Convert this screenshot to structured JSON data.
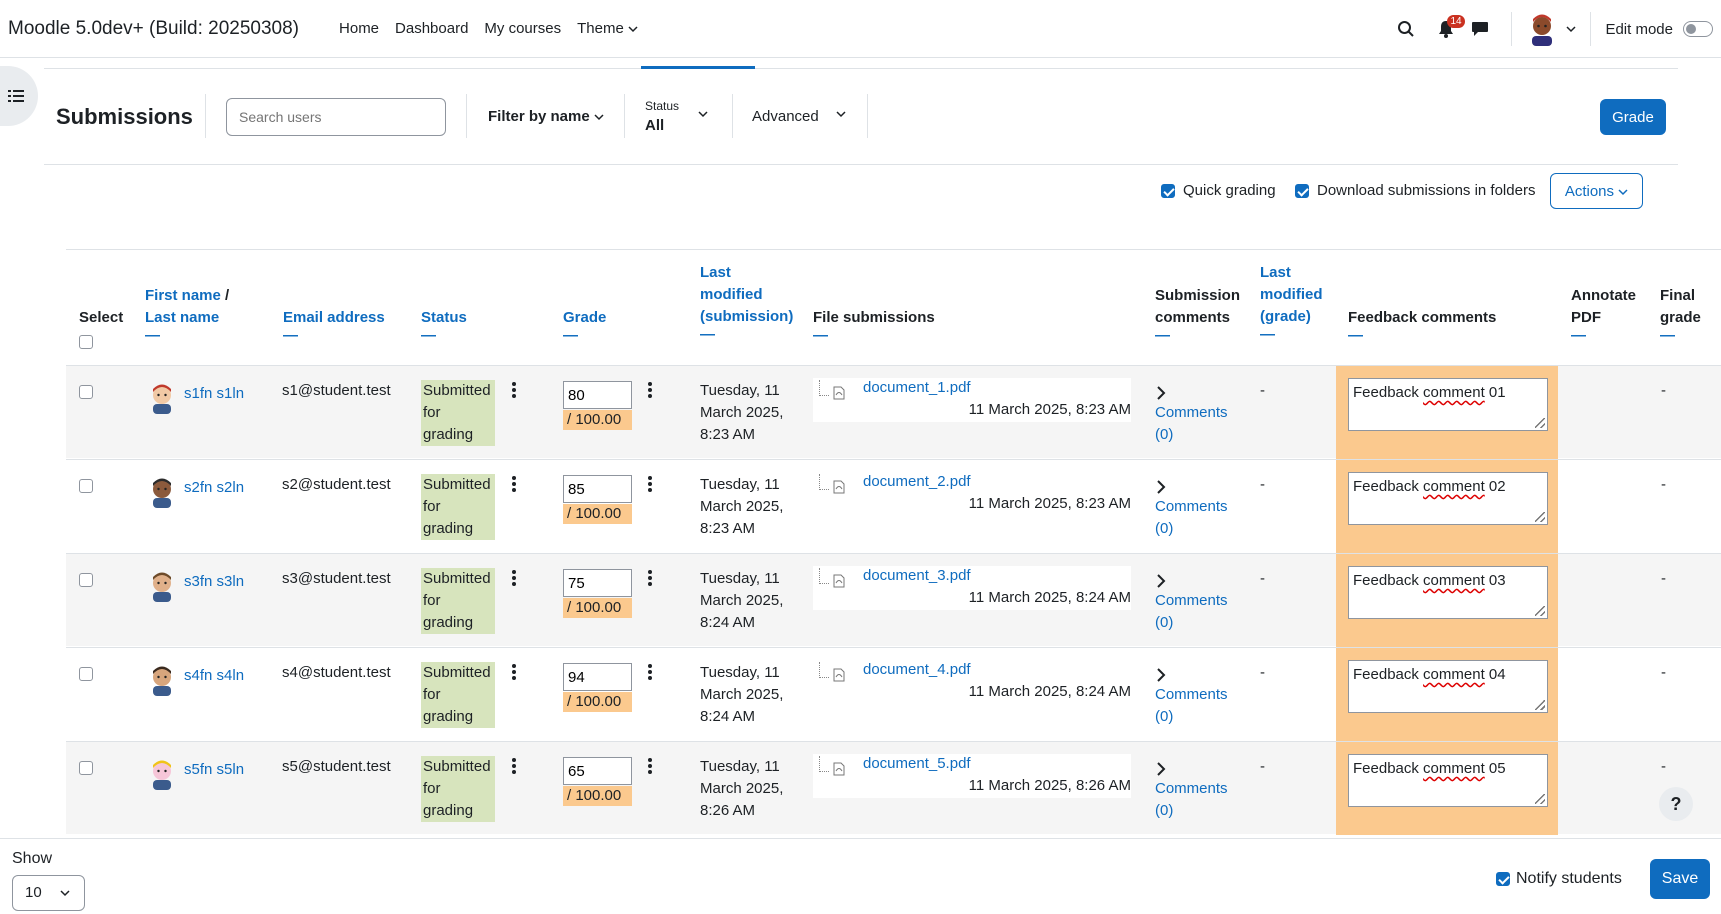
{
  "navbar": {
    "brand": "Moodle 5.0dev+ (Build: 20250308)",
    "links": [
      "Home",
      "Dashboard",
      "My courses",
      "Theme"
    ],
    "notification_count": "14",
    "edit_mode_label": "Edit mode"
  },
  "toolbar": {
    "title": "Submissions",
    "search_placeholder": "Search users",
    "filter_by_name": "Filter by name",
    "status_label": "Status",
    "status_value": "All",
    "advanced": "Advanced",
    "grade_button": "Grade",
    "quick_grading": "Quick grading",
    "download_folders": "Download submissions in folders",
    "actions": "Actions"
  },
  "table": {
    "headers": {
      "select": "Select",
      "first_name": "First name",
      "name_sep": "/",
      "last_name": "Last name",
      "email": "Email address",
      "status": "Status",
      "grade": "Grade",
      "last_modified_sub_1": "Last",
      "last_modified_sub_2": "modified",
      "last_modified_sub_3": "(submission)",
      "file_submissions": "File submissions",
      "submission_comments_1": "Submission",
      "submission_comments_2": "comments",
      "last_modified_grade_1": "Last",
      "last_modified_grade_2": "modified",
      "last_modified_grade_3": "(grade)",
      "feedback_comments": "Feedback comments",
      "annotate_pdf_1": "Annotate",
      "annotate_pdf_2": "PDF",
      "final_grade_1": "Final",
      "final_grade_2": "grade",
      "sort_dash": "—"
    },
    "rows": [
      {
        "name": "s1fn s1ln",
        "email": "s1@student.test",
        "status_1": "Submitted",
        "status_2": "for",
        "status_3": "grading",
        "grade": "80",
        "grade_max": "/ 100.00",
        "modified_1": "Tuesday, 11",
        "modified_2": "March 2025,",
        "modified_3": "8:23 AM",
        "file": "document_1.pdf",
        "file_date": "11 March 2025, 8:23 AM",
        "comments_1": "Comments",
        "comments_2": "(0)",
        "last_graded": "-",
        "feedback_word_1": "Feedback",
        "feedback_word_2": "comment",
        "feedback_word_3": "01",
        "final": "-"
      },
      {
        "name": "s2fn s2ln",
        "email": "s2@student.test",
        "status_1": "Submitted",
        "status_2": "for",
        "status_3": "grading",
        "grade": "85",
        "grade_max": "/ 100.00",
        "modified_1": "Tuesday, 11",
        "modified_2": "March 2025,",
        "modified_3": "8:23 AM",
        "file": "document_2.pdf",
        "file_date": "11 March 2025, 8:23 AM",
        "comments_1": "Comments",
        "comments_2": "(0)",
        "last_graded": "-",
        "feedback_word_1": "Feedback",
        "feedback_word_2": "comment",
        "feedback_word_3": "02",
        "final": "-"
      },
      {
        "name": "s3fn s3ln",
        "email": "s3@student.test",
        "status_1": "Submitted",
        "status_2": "for",
        "status_3": "grading",
        "grade": "75",
        "grade_max": "/ 100.00",
        "modified_1": "Tuesday, 11",
        "modified_2": "March 2025,",
        "modified_3": "8:24 AM",
        "file": "document_3.pdf",
        "file_date": "11 March 2025, 8:24 AM",
        "comments_1": "Comments",
        "comments_2": "(0)",
        "last_graded": "-",
        "feedback_word_1": "Feedback",
        "feedback_word_2": "comment",
        "feedback_word_3": "03",
        "final": "-"
      },
      {
        "name": "s4fn s4ln",
        "email": "s4@student.test",
        "status_1": "Submitted",
        "status_2": "for",
        "status_3": "grading",
        "grade": "94",
        "grade_max": "/ 100.00",
        "modified_1": "Tuesday, 11",
        "modified_2": "March 2025,",
        "modified_3": "8:24 AM",
        "file": "document_4.pdf",
        "file_date": "11 March 2025, 8:24 AM",
        "comments_1": "Comments",
        "comments_2": "(0)",
        "last_graded": "-",
        "feedback_word_1": "Feedback",
        "feedback_word_2": "comment",
        "feedback_word_3": "04",
        "final": "-"
      },
      {
        "name": "s5fn s5ln",
        "email": "s5@student.test",
        "status_1": "Submitted",
        "status_2": "for",
        "status_3": "grading",
        "grade": "65",
        "grade_max": "/ 100.00",
        "modified_1": "Tuesday, 11",
        "modified_2": "March 2025,",
        "modified_3": "8:26 AM",
        "file": "document_5.pdf",
        "file_date": "11 March 2025, 8:26 AM",
        "comments_1": "Comments",
        "comments_2": "(0)",
        "last_graded": "-",
        "feedback_word_1": "Feedback",
        "feedback_word_2": "comment",
        "feedback_word_3": "05",
        "final": "-"
      }
    ]
  },
  "footer": {
    "show_label": "Show",
    "show_value": "10",
    "notify_students": "Notify students",
    "save": "Save",
    "help": "?"
  },
  "colors": {
    "accent": "#0f6cbf",
    "submitted_bg": "#d7e4bd",
    "grade_highlight": "#fbc98e"
  }
}
